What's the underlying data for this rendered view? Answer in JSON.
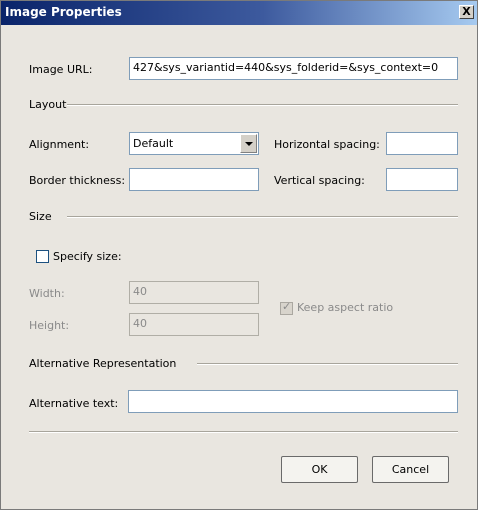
{
  "window": {
    "title": "Image Properties",
    "close_label": "X"
  },
  "image_url": {
    "label": "Image URL:",
    "value": "427&sys_variantid=440&sys_folderid=&sys_context=0"
  },
  "layout": {
    "section_label": "Layout",
    "alignment_label": "Alignment:",
    "alignment_value": "Default",
    "horizontal_spacing_label": "Horizontal spacing:",
    "horizontal_spacing_value": "",
    "border_thickness_label": "Border thickness:",
    "border_thickness_value": "",
    "vertical_spacing_label": "Vertical spacing:",
    "vertical_spacing_value": ""
  },
  "size": {
    "section_label": "Size",
    "specify_size_label": "Specify size:",
    "specify_size_checked": false,
    "width_label": "Width:",
    "width_value": "40",
    "height_label": "Height:",
    "height_value": "40",
    "keep_aspect_label": "Keep aspect ratio",
    "keep_aspect_checked": true
  },
  "alternative": {
    "section_label": "Alternative Representation",
    "alt_text_label": "Alternative text:",
    "alt_text_value": ""
  },
  "buttons": {
    "ok": "OK",
    "cancel": "Cancel"
  }
}
